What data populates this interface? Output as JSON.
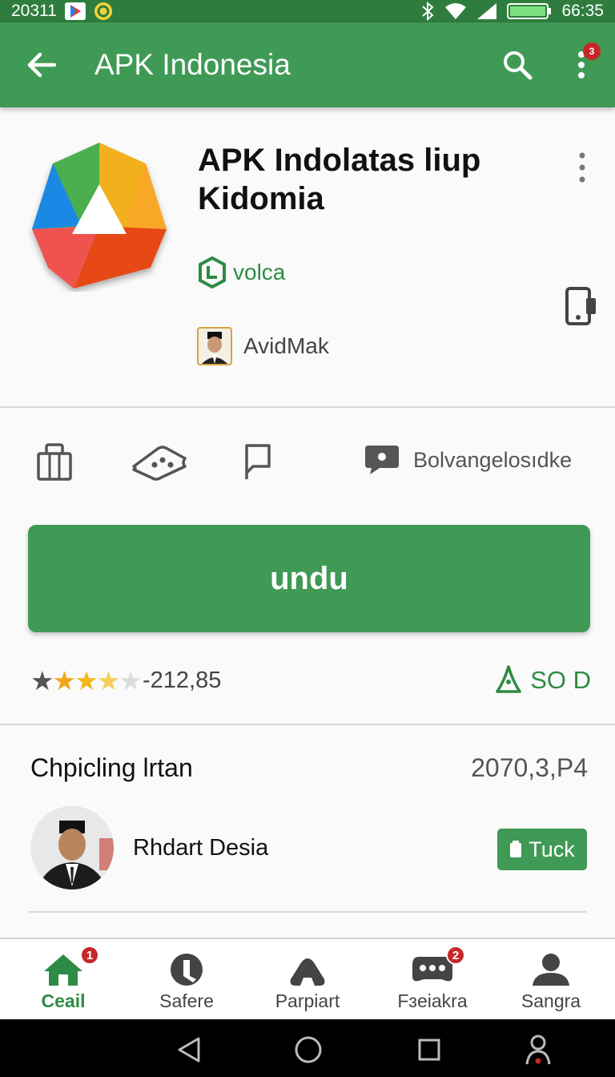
{
  "status_bar": {
    "left_text": "20311",
    "time": "66:35"
  },
  "app_bar": {
    "title": "APK Indonesia",
    "menu_badge": "3",
    "icons": [
      "back-arrow-icon",
      "search-icon",
      "more-vert-icon"
    ]
  },
  "app": {
    "name": "APK Indolatas liup Kidomia",
    "developer": "volca",
    "publisher": "AvidMak"
  },
  "actions": {
    "feedback_label": "Bolvangelosıdke",
    "icons": [
      "shopping-bag-icon",
      "ticket-icon",
      "flag-icon",
      "chat-icon"
    ]
  },
  "install": {
    "label": "undu"
  },
  "rating": {
    "stars": 3.5,
    "count": "-212,85",
    "size": "SO D"
  },
  "list": {
    "title": "Chpicling lrtan",
    "date": "2070,3,P4",
    "items": [
      {
        "name": "Rhdart Desia",
        "button_label": "Tuck"
      }
    ]
  },
  "bottom_nav": {
    "items": [
      {
        "label": "Ceail",
        "badge": "1",
        "active": true
      },
      {
        "label": "Safere",
        "badge": "",
        "active": false
      },
      {
        "label": "Parpiart",
        "badge": "",
        "active": false
      },
      {
        "label": "Fɜeiakra",
        "badge": "2",
        "active": false
      },
      {
        "label": "Sangra",
        "badge": "",
        "active": false
      }
    ]
  },
  "colors": {
    "primary": "#3f9a55",
    "status_bar": "#2e7d3e",
    "accent_text": "#2e8b45",
    "badge": "#c62828",
    "star": "#f2a51c"
  }
}
